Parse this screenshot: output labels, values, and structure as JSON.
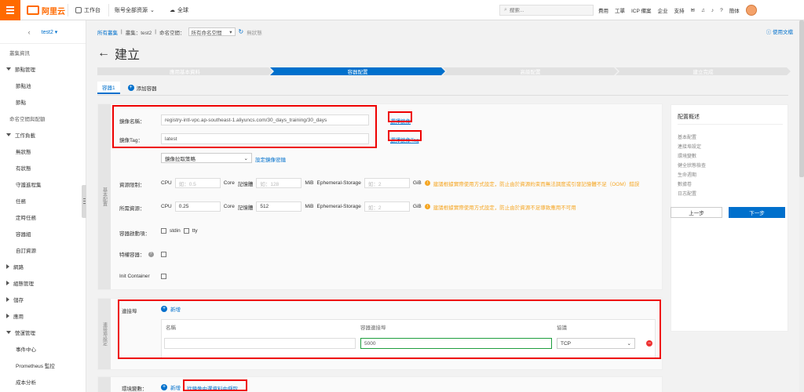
{
  "topbar": {
    "brand": "阿里云",
    "workbench": "工作台",
    "account": "账号全部资源",
    "region": "全球",
    "search_placeholder": "搜索...",
    "links": [
      "費用",
      "工單",
      "ICP 備案",
      "企业",
      "支持"
    ],
    "lang": "簡体"
  },
  "sidebar": {
    "cluster": "test2",
    "items": [
      {
        "label": "叢集資訊",
        "kind": "muted"
      },
      {
        "label": "節點管理",
        "kind": "top",
        "open": true
      },
      {
        "label": "節點池",
        "kind": "sub"
      },
      {
        "label": "節點",
        "kind": "sub"
      },
      {
        "label": "命名空間與配額",
        "kind": "muted"
      },
      {
        "label": "工作負載",
        "kind": "top",
        "open": true
      },
      {
        "label": "無狀態",
        "kind": "sub"
      },
      {
        "label": "有狀態",
        "kind": "sub"
      },
      {
        "label": "守護進程集",
        "kind": "sub"
      },
      {
        "label": "任務",
        "kind": "sub"
      },
      {
        "label": "定時任務",
        "kind": "sub"
      },
      {
        "label": "容器組",
        "kind": "sub"
      },
      {
        "label": "自訂資源",
        "kind": "sub"
      },
      {
        "label": "網路",
        "kind": "top",
        "open": false
      },
      {
        "label": "組態管理",
        "kind": "top",
        "open": false
      },
      {
        "label": "儲存",
        "kind": "top",
        "open": false
      },
      {
        "label": "應用",
        "kind": "top",
        "open": false
      },
      {
        "label": "營運管理",
        "kind": "top",
        "open": true
      },
      {
        "label": "事件中心",
        "kind": "sub"
      },
      {
        "label": "Prometheus 監控",
        "kind": "sub"
      },
      {
        "label": "成本分析",
        "kind": "sub"
      }
    ]
  },
  "breadcrumb": {
    "all_clusters": "所有叢集",
    "cluster": "叢集：test2",
    "ns_label": "命名空間：",
    "ns_value": "所有命名空間",
    "back_link": "無狀態",
    "help": "使用文檔"
  },
  "page_title": "建立",
  "steps": [
    "應用基本資料",
    "容器配置",
    "高級配置",
    "建立完成"
  ],
  "tabs": {
    "container1": "容器1",
    "add": "添加容器"
  },
  "basic": {
    "side_label": "基本配置",
    "image_name_label": "鏡像名稱：",
    "image_name_value": "registry-intl-vpc.ap-southeast-1.aliyuncs.com/30_days_training/30_days",
    "select_image": "選擇鏡像",
    "image_tag_label": "鏡像Tag：",
    "image_tag_value": "latest",
    "select_tag": "選擇鏡像Tag",
    "pull_policy": "鏡像拉取策略",
    "pull_secret": "設定鏡像密鑰",
    "limit_label": "資源限制：",
    "cpu": "CPU",
    "core": "Core",
    "mem": "記憶體",
    "mib": "MiB",
    "eph": "Ephemeral-Storage",
    "gib": "GiB",
    "limit_cpu_ph": "如：0.5",
    "limit_mem_ph": "如：128",
    "limit_eph_ph": "如：2",
    "limit_warn": "建議根據實際使用方式設定，防止由於資源約束而無法調度或引發記憶體不足（OOM）錯誤",
    "request_label": "所需資源：",
    "request_cpu": "0.25",
    "request_mem": "512",
    "request_eph_ph": "如：2",
    "request_warn": "建議根據實際使用方式設定，防止由於資源不足導致應用不可用",
    "startup_label": "容器啟動項：",
    "stdin": "stdin",
    "tty": "tty",
    "privileged_label": "特權容器：",
    "init_label": "Init Container"
  },
  "port": {
    "side_label": "連接埠設定",
    "label": "連接埠",
    "add": "新增",
    "col_name": "名稱",
    "col_port": "容器連接埠",
    "col_proto": "協議",
    "row_name": "",
    "row_port": "5000",
    "row_proto": "TCP"
  },
  "env": {
    "label": "環境變數：",
    "add": "新增",
    "from_config": "從鏡像中選資料中擷取"
  },
  "summary": {
    "title": "配置概述",
    "items": [
      "基本配置",
      "連接埠設定",
      "環境變數",
      "健全狀態檢查",
      "生命週期",
      "數據卷",
      "日志配置"
    ]
  },
  "buttons": {
    "prev": "上一步",
    "next": "下一步"
  },
  "colors": {
    "accent": "#0070cc",
    "brand": "#ff6a00",
    "warn": "#f5a623",
    "highlight": "#e00000"
  }
}
